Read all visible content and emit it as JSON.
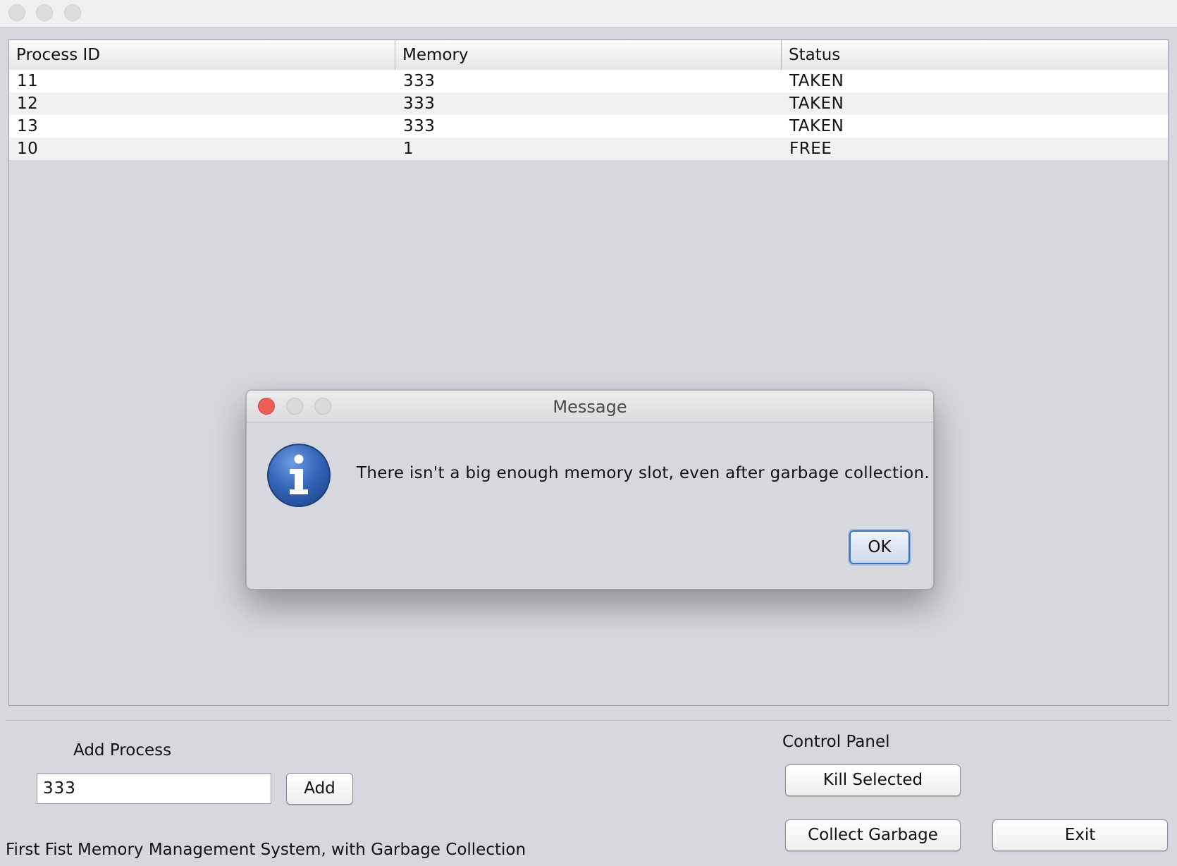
{
  "table": {
    "columns": [
      "Process ID",
      "Memory",
      "Status"
    ],
    "rows": [
      {
        "pid": "11",
        "memory": "333",
        "status": "TAKEN"
      },
      {
        "pid": "12",
        "memory": "333",
        "status": "TAKEN"
      },
      {
        "pid": "13",
        "memory": "333",
        "status": "TAKEN"
      },
      {
        "pid": "10",
        "memory": "1",
        "status": "FREE"
      }
    ]
  },
  "add_process": {
    "label": "Add Process",
    "input_value": "333",
    "add_label": "Add"
  },
  "control_panel": {
    "label": "Control Panel",
    "kill_label": "Kill Selected",
    "collect_label": "Collect Garbage",
    "exit_label": "Exit"
  },
  "footer": {
    "status_text": "First Fist Memory Management System, with Garbage Collection"
  },
  "dialog": {
    "title": "Message",
    "message": "There isn't a big enough memory slot, even after garbage collection.",
    "ok_label": "OK",
    "icon": "info-icon"
  },
  "colors": {
    "close_dot": "#ec5f57",
    "info_blue": "#2f5fb0",
    "focus_ring": "#3b73c4"
  }
}
